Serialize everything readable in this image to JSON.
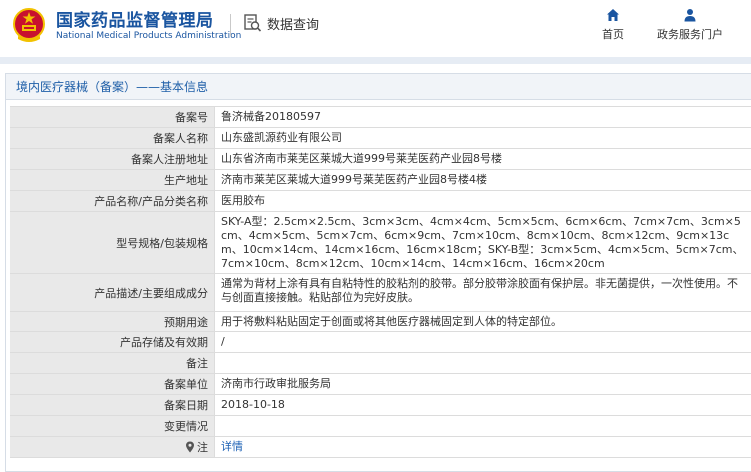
{
  "header": {
    "brand_cn": "国家药品监督管理局",
    "brand_en": "National Medical Products Administration",
    "data_query": "数据查询",
    "nav": [
      {
        "label": "首页",
        "icon": "home-icon"
      },
      {
        "label": "政务服务门户",
        "icon": "user-icon"
      }
    ]
  },
  "breadcrumb": {
    "text": "境内医疗器械（备案）——基本信息"
  },
  "record": [
    {
      "label": "备案号",
      "value": "鲁济械备20180597"
    },
    {
      "label": "备案人名称",
      "value": "山东盛凯源药业有限公司"
    },
    {
      "label": "备案人注册地址",
      "value": "山东省济南市莱芜区莱城大道999号莱芜医药产业园8号楼"
    },
    {
      "label": "生产地址",
      "value": "济南市莱芜区莱城大道999号莱芜医药产业园8号楼4楼"
    },
    {
      "label": "产品名称/产品分类名称",
      "value": "医用胶布"
    },
    {
      "label": "型号规格/包装规格",
      "value": "SKY-A型：2.5cm×2.5cm、3cm×3cm、4cm×4cm、5cm×5cm、6cm×6cm、7cm×7cm、3cm×5cm、4cm×5cm、5cm×7cm、6cm×9cm、7cm×10cm、8cm×10cm、8cm×12cm、9cm×13cm、10cm×14cm、14cm×16cm、16cm×18cm；SKY-B型：3cm×5cm、4cm×5cm、5cm×7cm、7cm×10cm、8cm×12cm、10cm×14cm、14cm×16cm、16cm×20cm"
    },
    {
      "label": "产品描述/主要组成成分",
      "value": "通常为背材上涂有具有自粘特性的胶粘剂的胶带。部分胶带涂胶面有保护层。非无菌提供，一次性使用。不与创面直接接触。粘贴部位为完好皮肤。"
    },
    {
      "label": "预期用途",
      "value": "用于将敷料粘贴固定于创面或将其他医疗器械固定到人体的特定部位。"
    },
    {
      "label": "产品存储及有效期",
      "value": "/"
    },
    {
      "label": "备注",
      "value": ""
    },
    {
      "label": "备案单位",
      "value": "济南市行政审批服务局"
    },
    {
      "label": "备案日期",
      "value": "2018-10-18"
    },
    {
      "label": "变更情况",
      "value": ""
    },
    {
      "label": "注",
      "value": "详情",
      "icon": "pin-icon"
    }
  ],
  "colors": {
    "brand_blue": "#1a55a0",
    "link_blue": "#1a5fb4",
    "label_bg": "#e9e9e9",
    "emblem_red": "#c8102e",
    "emblem_gold": "#f2c200"
  }
}
